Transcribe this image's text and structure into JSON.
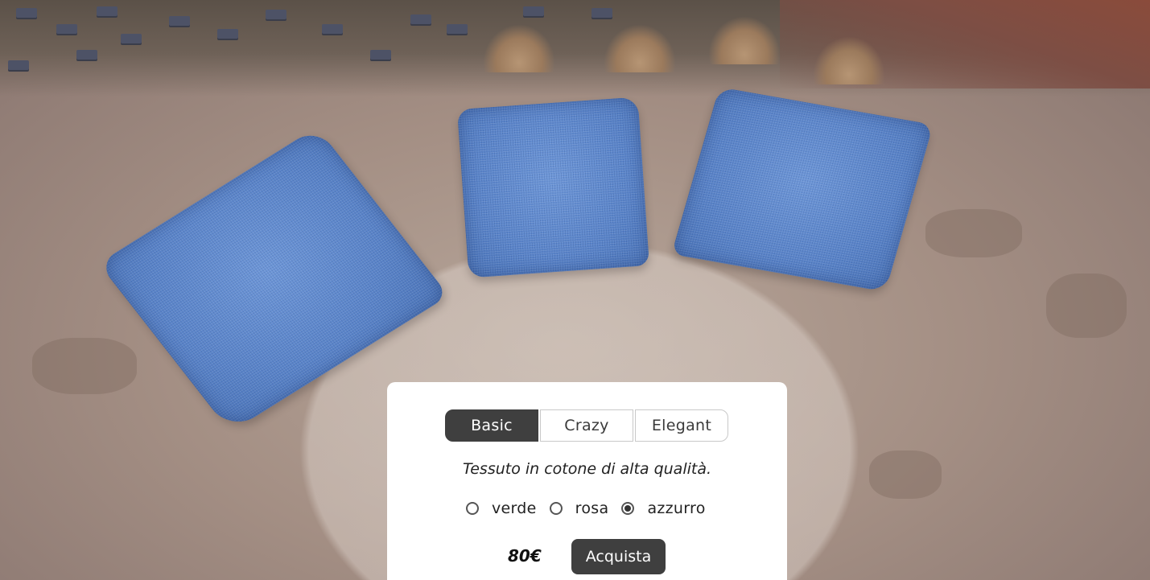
{
  "tabs": [
    {
      "label": "Basic",
      "active": true
    },
    {
      "label": "Crazy",
      "active": false
    },
    {
      "label": "Elegant",
      "active": false
    }
  ],
  "description": "Tessuto in cotone di alta qualità.",
  "colors": [
    {
      "label": "verde",
      "selected": false
    },
    {
      "label": "rosa",
      "selected": false
    },
    {
      "label": "azzurro",
      "selected": true
    }
  ],
  "price": "80€",
  "buy_label": "Acquista",
  "accent_colors": {
    "pillow": "#5b86cc",
    "dark_ui": "#3f3f3f"
  }
}
